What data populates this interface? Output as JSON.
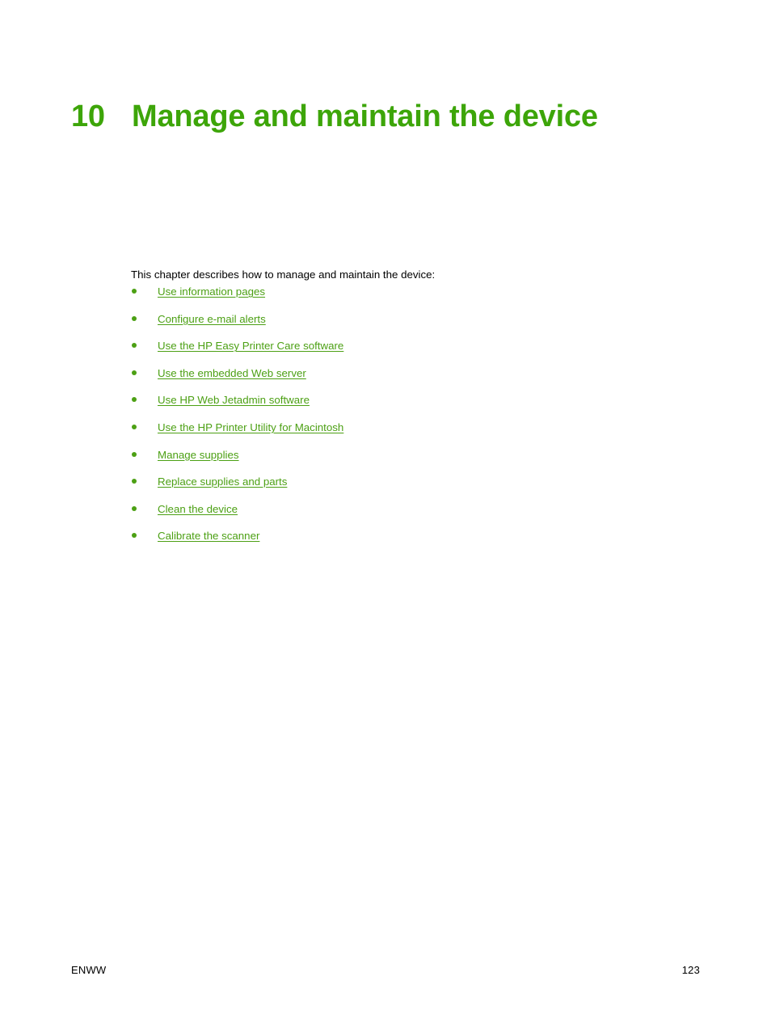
{
  "document": {
    "chapter": {
      "number": "10",
      "title": "Manage and maintain the device"
    },
    "intro_text": "This chapter describes how to manage and maintain the device:",
    "links": [
      {
        "label": "Use information pages"
      },
      {
        "label": "Configure e-mail alerts"
      },
      {
        "label": "Use the HP Easy Printer Care software"
      },
      {
        "label": "Use the embedded Web server"
      },
      {
        "label": "Use HP Web Jetadmin software"
      },
      {
        "label": "Use the HP Printer Utility for Macintosh"
      },
      {
        "label": "Manage supplies"
      },
      {
        "label": "Replace supplies and parts"
      },
      {
        "label": "Clean the device"
      },
      {
        "label": "Calibrate the scanner"
      }
    ],
    "footer": {
      "left": "ENWW",
      "page_number": "123"
    },
    "colors": {
      "heading_green": "#3da509",
      "link_green": "#4ca014",
      "body_black": "#000000",
      "page_background": "#ffffff"
    }
  }
}
